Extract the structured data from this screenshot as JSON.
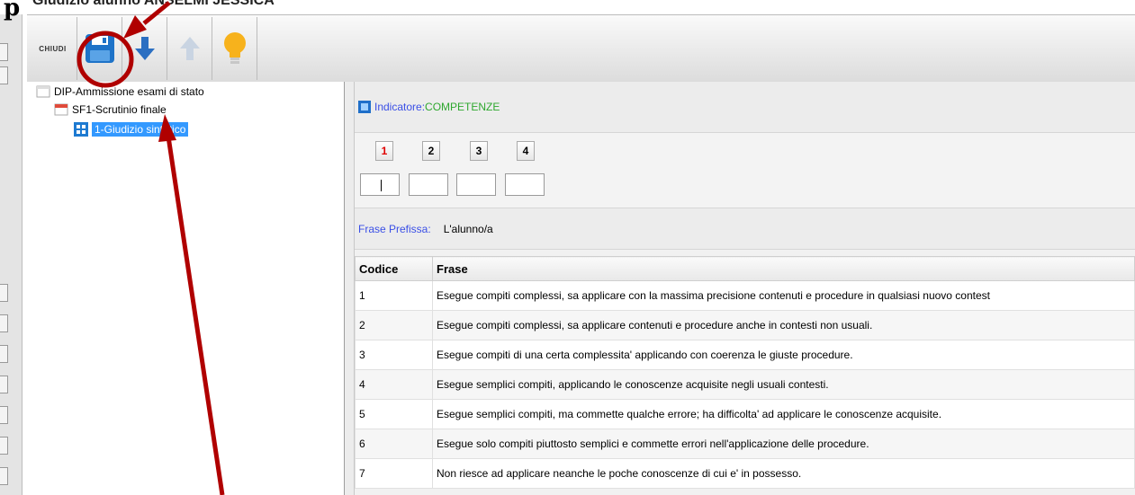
{
  "window": {
    "title": "Giudizio alunno ANSELMI JESSICA"
  },
  "corner_letter": "p",
  "toolbar": {
    "close_label": "CHIUDI",
    "buttons": [
      {
        "icon": "save-icon",
        "color": "#1e73c8"
      },
      {
        "icon": "arrow-down-icon",
        "color": "#2b6fc2"
      },
      {
        "icon": "arrow-up-icon",
        "color": "#c9d4e2"
      },
      {
        "icon": "lightbulb-icon",
        "color": "#f7b21c"
      }
    ]
  },
  "tree": {
    "items": [
      {
        "label": "DIP-Ammissione esami di stato"
      },
      {
        "label": "SF1-Scrutinio finale"
      },
      {
        "label": "1-Giudizio sintetico"
      }
    ]
  },
  "panel": {
    "indicator_label": "Indicatore:",
    "indicator_value": "COMPETENZE",
    "levels": [
      "1",
      "2",
      "3",
      "4"
    ],
    "prefix_label": "Frase Prefissa:",
    "prefix_value": "L'alunno/a"
  },
  "table": {
    "columns": [
      "Codice",
      "Frase"
    ],
    "rows": [
      {
        "code": "1",
        "phrase": "Esegue compiti complessi, sa applicare con la massima precisione contenuti e procedure in qualsiasi nuovo contest"
      },
      {
        "code": "2",
        "phrase": "Esegue compiti complessi, sa applicare contenuti e procedure anche in contesti non usuali."
      },
      {
        "code": "3",
        "phrase": "Esegue compiti di una certa complessita' applicando con coerenza le giuste procedure."
      },
      {
        "code": "4",
        "phrase": "Esegue semplici compiti, applicando le conoscenze acquisite negli usuali contesti."
      },
      {
        "code": "5",
        "phrase": "Esegue semplici compiti, ma commette qualche errore; ha difficolta' ad applicare le conoscenze acquisite."
      },
      {
        "code": "6",
        "phrase": "Esegue solo compiti piuttosto semplici e commette errori nell'applicazione delle procedure."
      },
      {
        "code": "7",
        "phrase": "Non riesce ad applicare neanche le poche conoscenze di cui e' in possesso."
      }
    ]
  },
  "annotations": {
    "color": "#b00000"
  }
}
